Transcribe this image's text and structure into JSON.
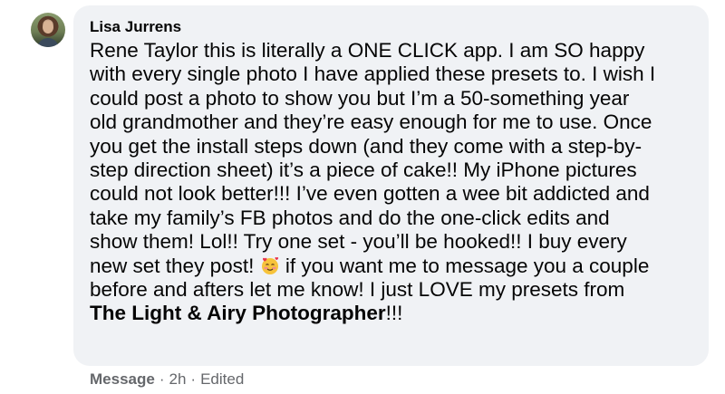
{
  "comment": {
    "author": "Lisa Jurrens",
    "body_lines": [
      "Rene Taylor this is literally a ONE CLICK app. I am SO happy",
      "with every single photo I have applied these presets to. I wish I",
      "could post a photo to show you but I’m a 50-something year",
      "old grandmother and they’re easy enough for me to use. Once",
      "you get the install steps down (and they come with a step-by-",
      "step direction sheet) it’s a piece of cake!! My iPhone pictures",
      "could not look better!!! I’ve even gotten a wee bit addicted and",
      "take my family’s FB photos and do the one-click edits and",
      "show them! Lol!! Try one set - you’ll be hooked!! I buy every"
    ],
    "line_10_before_emoji": "new set they post! ",
    "line_10_after_emoji": " if you want me to message you a couple",
    "line_11": "before and afters let me know! I just LOVE my presets from",
    "bold_page_name": "The Light & Airy Photographer",
    "trailing_text": "!!!",
    "emoji_icon": "smiling-face-with-hearts-icon"
  },
  "meta": {
    "action_label": "Message",
    "separator": "·",
    "time": "2h",
    "edited_label": "Edited"
  },
  "colors": {
    "bubble_bg": "#f0f2f5",
    "text": "#050505",
    "meta_text": "#65676b"
  }
}
